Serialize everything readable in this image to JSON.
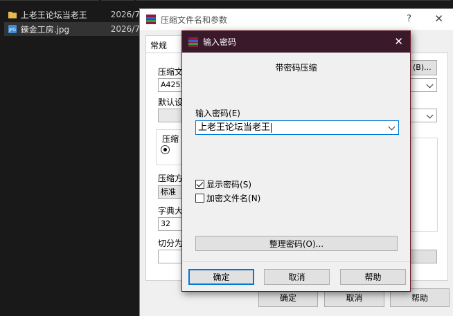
{
  "explorer": {
    "files": [
      {
        "name": "上老王论坛当老王",
        "date": "2026/7/",
        "icon": "folder-icon"
      },
      {
        "name": "鍊金工房.jpg",
        "date": "2026/7/",
        "icon": "jpg-file-icon"
      }
    ]
  },
  "main_dialog": {
    "title": "压缩文件名和参数",
    "help_glyph": "?",
    "close_glyph": "✕",
    "tab_general": "常规",
    "archive_name_label": "压缩文",
    "archive_name_value": "A4255",
    "browse_button": "(B)...",
    "default_profile_label": "默认设",
    "group_label": "压缩",
    "compression_method_label": "压缩方",
    "compression_method_value": "标准",
    "dictionary_size_label": "字典大",
    "dictionary_size_value": "32",
    "split_label": "切分为",
    "ok_button": "确定",
    "cancel_button": "取消",
    "help_button": "帮助"
  },
  "password_dialog": {
    "title": "输入密码",
    "close_glyph": "✕",
    "heading": "带密码压缩",
    "enter_password_label": "输入密码",
    "enter_password_hotkey": "(E)",
    "password_value": "上老王论坛当老王",
    "show_password_label": "显示密码",
    "show_password_hotkey": "(S)",
    "show_password_checked": true,
    "encrypt_filenames_label": "加密文件名",
    "encrypt_filenames_hotkey": "(N)",
    "encrypt_filenames_checked": false,
    "organize_button": "整理密码(O)...",
    "ok_button": "确定",
    "cancel_button": "取消",
    "help_button": "帮助"
  },
  "colors": {
    "password_titlebar": "#3a1a2a",
    "focus_accent": "#0078d7",
    "explorer_bg": "#191919"
  }
}
